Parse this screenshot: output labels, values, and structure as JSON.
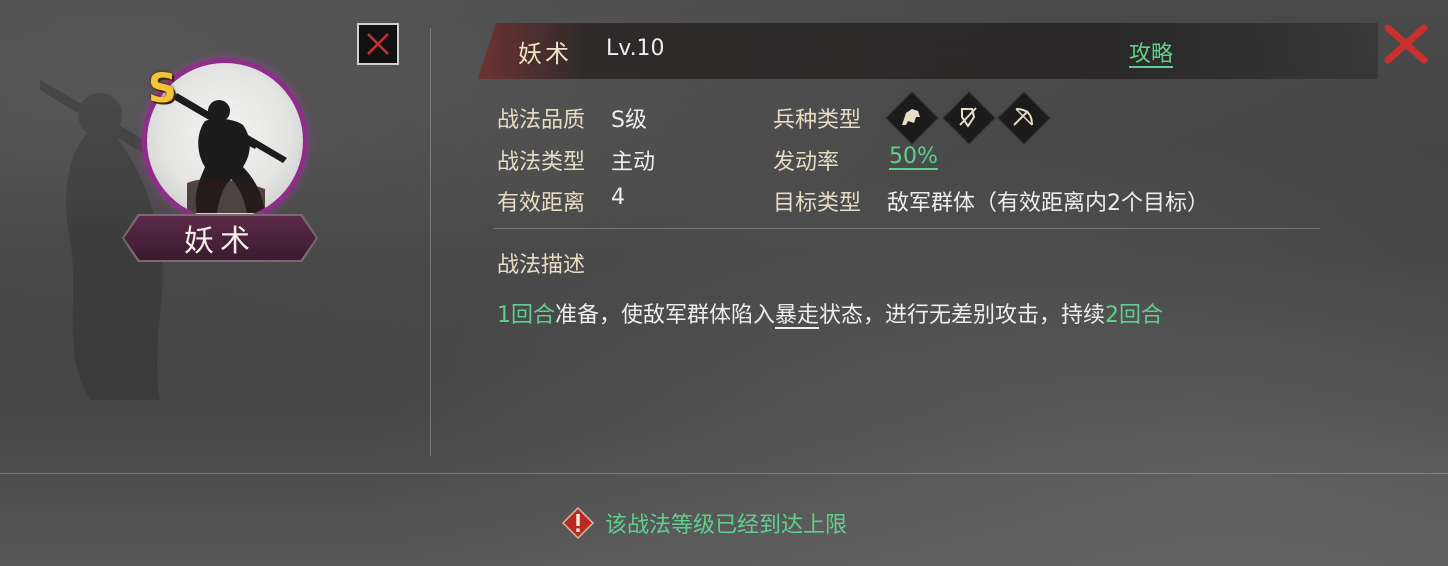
{
  "skill": {
    "name": "妖术",
    "grade_badge": "S",
    "plate_name": "妖术"
  },
  "header": {
    "name": "妖术",
    "level": "Lv.10",
    "guide_label": "攻略"
  },
  "attributes": {
    "quality_label": "战法品质",
    "quality_value": "S级",
    "type_label": "战法类型",
    "type_value": "主动",
    "range_label": "有效距离",
    "range_value": "4",
    "troop_label": "兵种类型",
    "troop_icons": [
      "cavalry-icon",
      "shield-icon",
      "archer-icon"
    ],
    "rate_label": "发动率",
    "rate_value": "50%",
    "target_label": "目标类型",
    "target_value": "敌军群体（有效距离内2个目标）"
  },
  "description": {
    "title": "战法描述",
    "part1_green": "1回合",
    "part2": "准备，使敌军群体陷入",
    "part3_keyword": "暴走",
    "part4": "状态，进行无差别攻击，持续",
    "part5_green": "2回合"
  },
  "footer": {
    "warning": "该战法等级已经到达上限"
  },
  "colors": {
    "accent_green": "#5fd08c",
    "ring_purple": "#8e2e8a",
    "badge_gold": "#f3c43a",
    "close_red": "#c8322e"
  }
}
